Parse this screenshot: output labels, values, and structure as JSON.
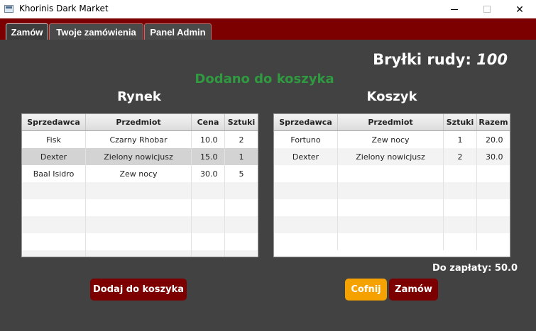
{
  "window": {
    "title": "Khorinis Dark Market"
  },
  "tabs": [
    {
      "label": "Zamów"
    },
    {
      "label": "Twoje zamówienia"
    },
    {
      "label": "Panel Admin"
    }
  ],
  "ore": {
    "label": "Bryłki rudy:",
    "value": "100"
  },
  "status": {
    "message": "Dodano do koszyka"
  },
  "market": {
    "heading": "Rynek",
    "columns": [
      "Sprzedawca",
      "Przedmiot",
      "Cena",
      "Sztuki"
    ],
    "rows": [
      {
        "seller": "Fisk",
        "item": "Czarny Rhobar",
        "price": "10.0",
        "qty": "2"
      },
      {
        "seller": "Dexter",
        "item": "Zielony nowicjusz",
        "price": "15.0",
        "qty": "1"
      },
      {
        "seller": "Baal Isidro",
        "item": "Zew nocy",
        "price": "30.0",
        "qty": "5"
      }
    ]
  },
  "cart": {
    "heading": "Koszyk",
    "columns": [
      "Sprzedawca",
      "Przedmiot",
      "Sztuki",
      "Razem"
    ],
    "rows": [
      {
        "seller": "Fortuno",
        "item": "Zew nocy",
        "qty": "1",
        "total": "20.0"
      },
      {
        "seller": "Dexter",
        "item": "Zielony nowicjusz",
        "qty": "2",
        "total": "30.0"
      }
    ],
    "to_pay_label": "Do zapłaty:",
    "to_pay_value": "50.0"
  },
  "buttons": {
    "add_to_cart": "Dodaj do koszyka",
    "back": "Cofnij",
    "order": "Zamów"
  }
}
